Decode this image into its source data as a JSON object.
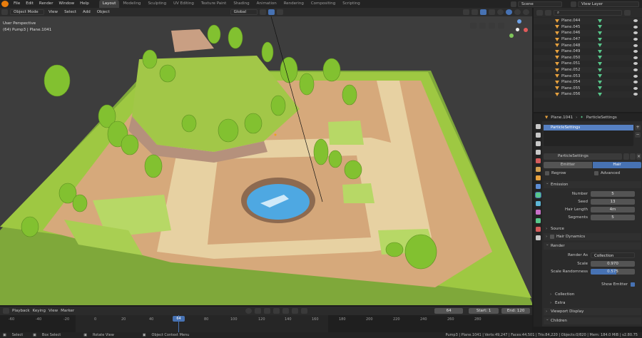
{
  "menu": [
    "File",
    "Edit",
    "Render",
    "Window",
    "Help"
  ],
  "workspaces": [
    "Layout",
    "Modeling",
    "Sculpting",
    "UV Editing",
    "Texture Paint",
    "Shading",
    "Animation",
    "Rendering",
    "Compositing",
    "Scripting"
  ],
  "active_workspace": "Layout",
  "scene": {
    "label": "Scene",
    "view_layer": "View Layer"
  },
  "viewport_header": {
    "mode": "Object Mode",
    "menus": [
      "View",
      "Select",
      "Add",
      "Object"
    ],
    "orientation": "Global"
  },
  "viewport_info": {
    "line1": "User Perspective",
    "line2": "(64) Pump3 | Plane.1041"
  },
  "outliner": {
    "items": [
      "Plane.044",
      "Plane.045",
      "Plane.046",
      "Plane.047",
      "Plane.048",
      "Plane.049",
      "Plane.050",
      "Plane.051",
      "Plane.052",
      "Plane.053",
      "Plane.054",
      "Plane.055",
      "Plane.056"
    ]
  },
  "properties": {
    "object": "Plane.1041",
    "settings": "ParticleSettings",
    "slot": "ParticleSettings",
    "datablock": "ParticleSettings",
    "tabs": {
      "emitter": "Emitter",
      "hair": "Hair"
    },
    "regrow": "Regrow",
    "advanced": "Advanced",
    "emission": {
      "title": "Emission",
      "number_label": "Number",
      "number": "5",
      "seed_label": "Seed",
      "seed": "13",
      "hair_length_label": "Hair Length",
      "hair_length": "4m",
      "segments_label": "Segments",
      "segments": "5"
    },
    "source": "Source",
    "hair_dynamics": "Hair Dynamics",
    "render": {
      "title": "Render",
      "render_as_label": "Render As",
      "render_as": "Collection",
      "scale_label": "Scale",
      "scale": "0.970",
      "scale_rand_label": "Scale Randomness",
      "scale_rand": "0.575",
      "scale_rand_fraction": 0.575,
      "show_emitter": "Show Emitter"
    },
    "collection": "Collection",
    "extra": "Extra",
    "viewport_display": "Viewport Display",
    "children": "Children"
  },
  "timeline": {
    "menus": [
      "Playback",
      "Keying",
      "View",
      "Marker"
    ],
    "current_frame": "64",
    "start_label": "Start:",
    "start": "1",
    "end_label": "End:",
    "end": "120",
    "ticks": [
      "-60",
      "-40",
      "-20",
      "0",
      "20",
      "40",
      "60",
      "80",
      "100",
      "120",
      "140",
      "160",
      "180",
      "200",
      "220",
      "240",
      "260",
      "280"
    ]
  },
  "status": {
    "select": "Select",
    "box_select": "Box Select",
    "rotate": "Rotate View",
    "context": "Object Context Menu",
    "stats": "Pump3 | Plane.1041 | Verts:49,247 | Faces:44,501 | Tris:84,220 | Objects:0/820 | Mem: 184.0 MiB | v2.80.75"
  },
  "colors": {
    "accent": "#4772b3",
    "grass": "#9cc63f",
    "path": "#e6cf9f",
    "dirt": "#d4a77a",
    "water": "#4aa5e0"
  }
}
